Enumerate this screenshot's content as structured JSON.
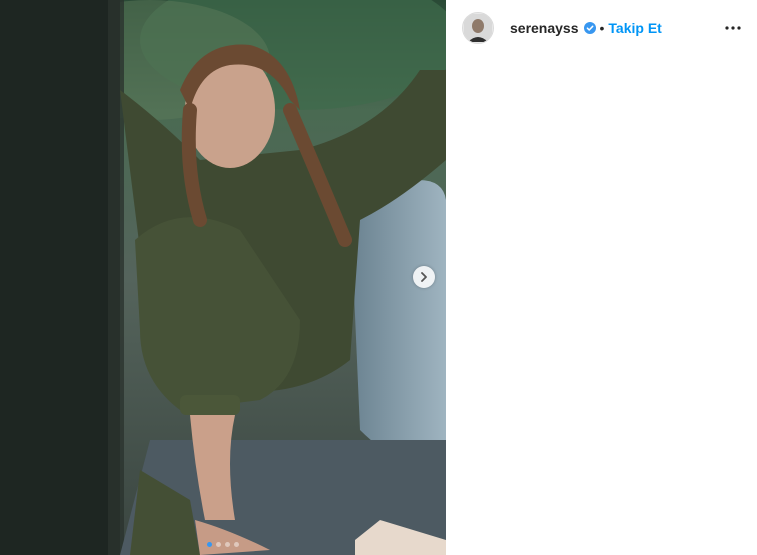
{
  "post": {
    "username": "serenayss",
    "verified": true,
    "separator": "•",
    "follow_label": "Takip Et",
    "more_icon": "more-horizontal-icon",
    "next_icon": "chevron-right-icon",
    "carousel": {
      "count": 4,
      "active_index": 0
    }
  },
  "colors": {
    "accent": "#0095f6",
    "text": "#262626",
    "active_dot": "#3797f0"
  }
}
